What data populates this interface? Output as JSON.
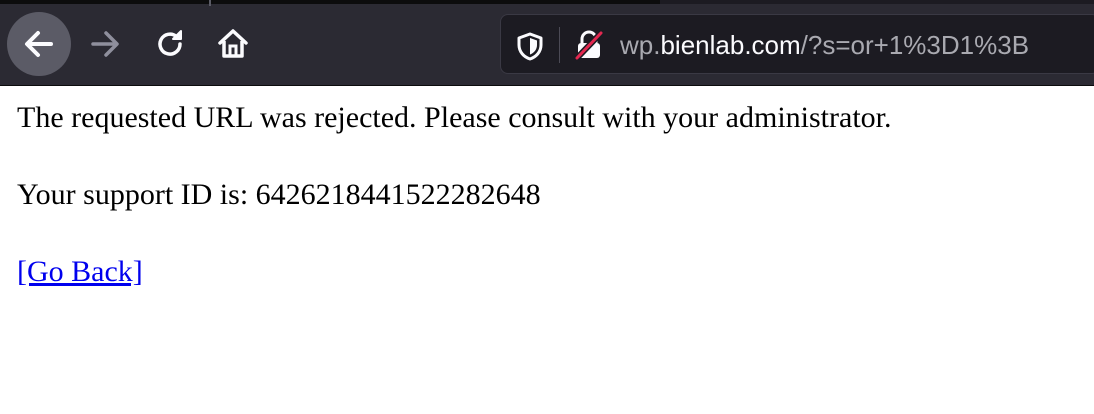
{
  "browser": {
    "url_prefix": "wp.",
    "url_host": "bienlab.com",
    "url_rest": "/?s=or+1%3D1%3B",
    "icons": {
      "back": "arrow-left-icon",
      "forward": "arrow-right-icon",
      "reload": "reload-icon",
      "home": "home-icon",
      "tracking": "shield-icon",
      "security": "insecure-lock-icon"
    },
    "colors": {
      "toolbar": "#2b2a33",
      "urlbar": "#1c1b22",
      "insecure_strike": "#e22850"
    }
  },
  "page": {
    "message": "The requested URL was rejected. Please consult with your administrator.",
    "support_line": "Your support ID is: 6426218441522282648",
    "go_back_link": "[Go Back]",
    "link_color": "#0000ee"
  }
}
